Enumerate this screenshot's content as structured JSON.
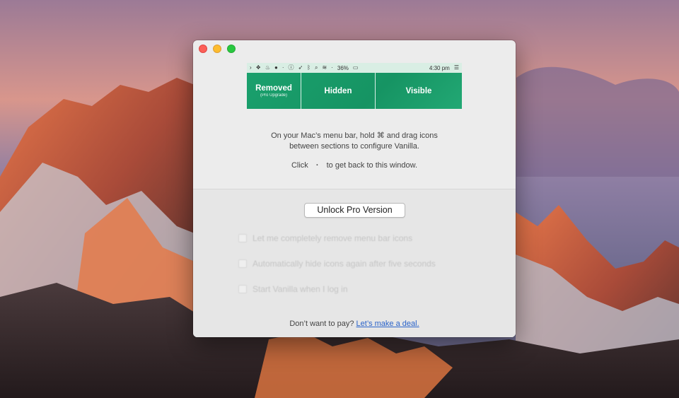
{
  "window": {
    "menubar_preview": {
      "status": {
        "battery": "36%",
        "time": "4:30 pm"
      },
      "sections": [
        {
          "title": "Removed",
          "subtitle": "(Pro Upgrade)"
        },
        {
          "title": "Hidden"
        },
        {
          "title": "Visible"
        }
      ]
    },
    "instructions": {
      "line1": "On your Mac’s menu bar, hold ⌘ and drag icons",
      "line2": "between sections to configure Vanilla.",
      "click_before": "Click",
      "click_glyph": "·",
      "click_after": "to get back to this window."
    },
    "unlock_button": "Unlock Pro Version",
    "options": [
      "Let me completely remove menu bar icons",
      "Automatically hide icons again after five seconds",
      "Start Vanilla when I log in"
    ],
    "footer": {
      "question": "Don’t want to pay?",
      "link": "Let’s make a deal."
    }
  },
  "colors": {
    "accent_green": "#1c9a6a",
    "link_blue": "#2a63c9",
    "close": "#fc5f57",
    "minimize": "#fdbc2e",
    "maximize": "#28c840"
  }
}
